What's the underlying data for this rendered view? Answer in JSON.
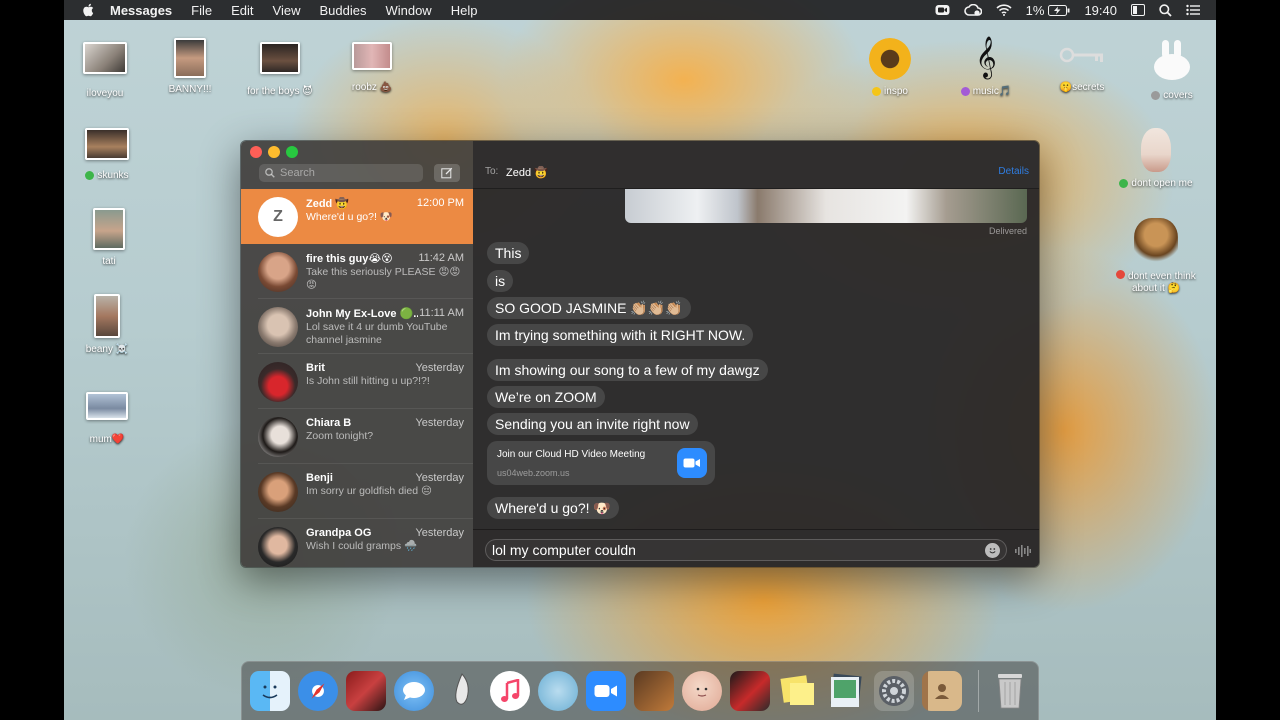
{
  "menubar": {
    "app_name": "Messages",
    "menus": [
      "File",
      "Edit",
      "View",
      "Buddies",
      "Window",
      "Help"
    ],
    "battery": "1%",
    "time": "19:40"
  },
  "desktop": {
    "icons_left": [
      {
        "label": "iloveyou"
      },
      {
        "label": "BANNY!!!"
      },
      {
        "label": "for the boys 😈"
      },
      {
        "label": "roobz 💩"
      },
      {
        "label": "skunks"
      },
      {
        "label": "tati"
      },
      {
        "label": "beany ☠️"
      },
      {
        "label": "mum❤️"
      }
    ],
    "icons_right": [
      {
        "label": "inspo"
      },
      {
        "label": "music🎵"
      },
      {
        "label": "🤫secrets"
      },
      {
        "label": "covers"
      },
      {
        "label": "dont open me"
      },
      {
        "label": "dont even think about it 🤔"
      }
    ]
  },
  "sidebar": {
    "search_placeholder": "Search",
    "conversations": [
      {
        "name": "Zedd 🤠",
        "time": "12:00 PM",
        "preview": "Where'd u go?! 🐶",
        "initial": "Z",
        "active": true
      },
      {
        "name": "fire this guy😭😵",
        "time": "11:42 AM",
        "preview": "Take this seriously PLEASE 😡😡😡"
      },
      {
        "name": "John My Ex-Love 🟢...",
        "time": "11:11 AM",
        "preview": "Lol save it 4 ur dumb YouTube channel jasmine"
      },
      {
        "name": "Brit",
        "time": "Yesterday",
        "preview": "Is John still hitting u up?!?!"
      },
      {
        "name": "Chiara B",
        "time": "Yesterday",
        "preview": "Zoom tonight?"
      },
      {
        "name": "Benji",
        "time": "Yesterday",
        "preview": "Im sorry ur goldfish died 😔"
      },
      {
        "name": "Grandpa OG",
        "time": "Yesterday",
        "preview": "Wish I could gramps 🌧️"
      }
    ]
  },
  "chat": {
    "to_label": "To:",
    "recipient": "Zedd 🤠",
    "details_label": "Details",
    "delivered_label": "Delivered",
    "messages": [
      "This",
      "is",
      "SO GOOD JASMINE 👏🏼👏🏼👏🏼",
      "Im trying something with it RIGHT NOW.",
      "Im showing our song to a few of my dawgz",
      "We’re on ZOOM",
      "Sending you an invite right now",
      "Where'd u go?! 🐶"
    ],
    "link_card": {
      "title": "Join our Cloud HD Video Meeting",
      "url": "us04web.zoom.us"
    },
    "input_value": "lol my computer couldn"
  },
  "dock": {
    "apps": [
      "finder-icon",
      "safari-icon",
      "photo-booth-icon",
      "messages-icon",
      "inkscape-icon",
      "music-icon",
      "seal-icon",
      "zoom-icon",
      "garageband-icon",
      "face-icon",
      "photo-app-icon",
      "stickies-icon",
      "preview-icon",
      "system-preferences-icon",
      "contacts-icon",
      "trash-icon"
    ]
  },
  "colors": {
    "accent": "#ec8a43",
    "zoom_blue": "#2d8cff",
    "bubble": "#474747",
    "link_blue": "#2f7de1"
  }
}
